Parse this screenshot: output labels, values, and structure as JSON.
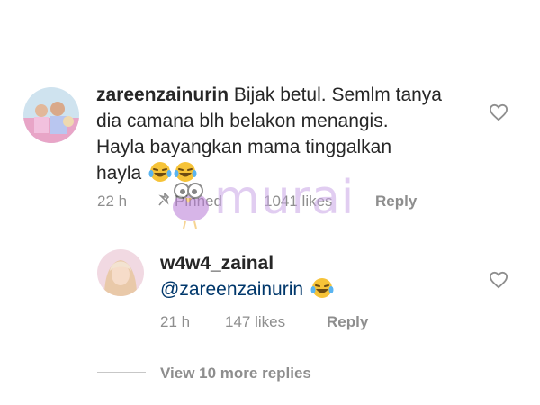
{
  "comments": [
    {
      "username": "zareenzainurin",
      "text_line1": " Bijak betul. Semlm tanya",
      "text_line2": "dia camana blh belakon menangis.",
      "text_line3": "Hayla bayangkan mama tinggalkan",
      "text_line4": "hayla",
      "emojis": [
        "laughing-tears",
        "laughing-tears"
      ],
      "time": "22 h",
      "pinned_label": "Pinned",
      "likes": "1041 likes",
      "reply_label": "Reply"
    },
    {
      "username": "w4w4_zainal",
      "mention": "@zareenzainurin",
      "emojis": [
        "laughing-tears"
      ],
      "time": "21 h",
      "likes": "147 likes",
      "reply_label": "Reply"
    }
  ],
  "view_more": "View 10 more replies",
  "watermark": "murai",
  "colors": {
    "text": "#262626",
    "secondary": "#8e8e8e",
    "mention": "#00376b",
    "watermark": "#c9a6e6"
  }
}
